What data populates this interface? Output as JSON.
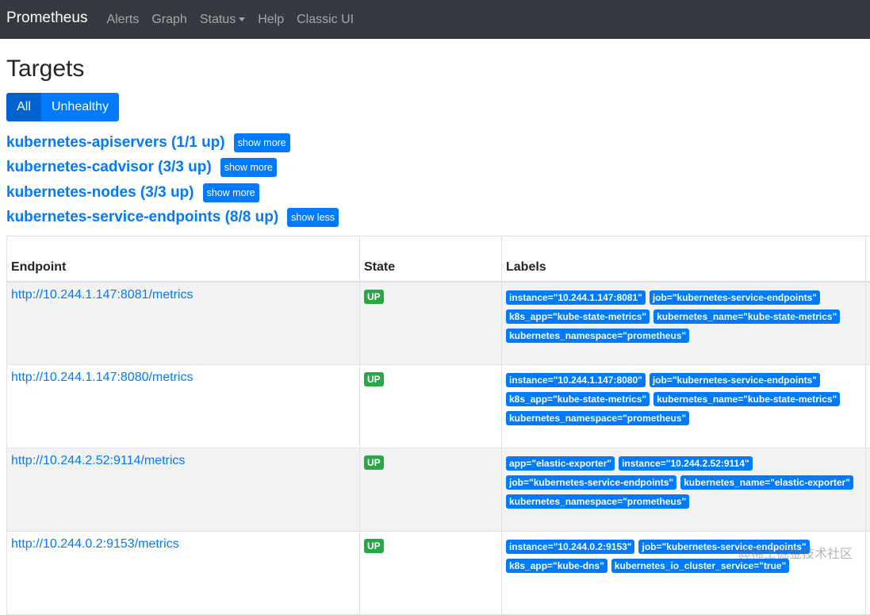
{
  "nav": {
    "brand": "Prometheus",
    "items": [
      "Alerts",
      "Graph",
      "Status",
      "Help",
      "Classic UI"
    ]
  },
  "page": {
    "title": "Targets",
    "filter": {
      "all": "All",
      "unhealthy": "Unhealthy"
    }
  },
  "pools": [
    {
      "title": "kubernetes-apiservers (1/1 up)",
      "button": "show more"
    },
    {
      "title": "kubernetes-cadvisor (3/3 up)",
      "button": "show more"
    },
    {
      "title": "kubernetes-nodes (3/3 up)",
      "button": "show more"
    },
    {
      "title": "kubernetes-service-endpoints (8/8 up)",
      "button": "show less"
    }
  ],
  "table": {
    "headers": {
      "endpoint": "Endpoint",
      "state": "State",
      "labels": "Labels"
    },
    "rows": [
      {
        "endpoint": "http://10.244.1.147:8081/metrics",
        "state": "UP",
        "labels": [
          "instance=\"10.244.1.147:8081\"",
          "job=\"kubernetes-service-endpoints\"",
          "k8s_app=\"kube-state-metrics\"",
          "kubernetes_name=\"kube-state-metrics\"",
          "kubernetes_namespace=\"prometheus\""
        ]
      },
      {
        "endpoint": "http://10.244.1.147:8080/metrics",
        "state": "UP",
        "labels": [
          "instance=\"10.244.1.147:8080\"",
          "job=\"kubernetes-service-endpoints\"",
          "k8s_app=\"kube-state-metrics\"",
          "kubernetes_name=\"kube-state-metrics\"",
          "kubernetes_namespace=\"prometheus\""
        ]
      },
      {
        "endpoint": "http://10.244.2.52:9114/metrics",
        "state": "UP",
        "labels": [
          "app=\"elastic-exporter\"",
          "instance=\"10.244.2.52:9114\"",
          "job=\"kubernetes-service-endpoints\"",
          "kubernetes_name=\"elastic-exporter\"",
          "kubernetes_namespace=\"prometheus\""
        ]
      },
      {
        "endpoint": "http://10.244.0.2:9153/metrics",
        "state": "UP",
        "labels": [
          "instance=\"10.244.0.2:9153\"",
          "job=\"kubernetes-service-endpoints\"",
          "k8s_app=\"kube-dns\"",
          "kubernetes_io_cluster_service=\"true\""
        ]
      }
    ]
  },
  "watermark": "@稀土掘金技术社区",
  "colors": {
    "navbar": "#343a40",
    "primary": "#007bff",
    "success": "#28a745"
  }
}
